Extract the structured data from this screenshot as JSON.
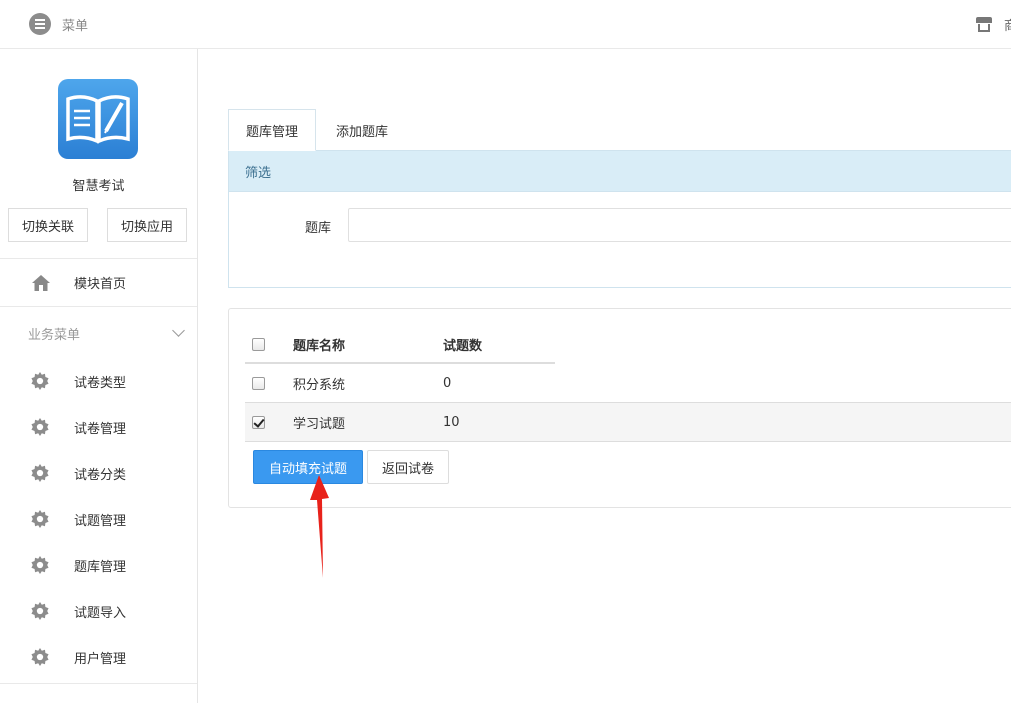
{
  "topbar": {
    "menu_label": "菜单",
    "menu_icon": "list-icon",
    "store_icon": "store-icon",
    "store_text": "商"
  },
  "sidebar": {
    "app_logo": "book-pen-logo",
    "app_name": "智慧考试",
    "switch_link": "切换关联",
    "switch_app": "切换应用",
    "home": {
      "label": "模块首页",
      "icon": "home-icon"
    },
    "section_title": "业务菜单",
    "items": [
      {
        "label": "试卷类型",
        "icon": "gear-icon"
      },
      {
        "label": "试卷管理",
        "icon": "gear-icon"
      },
      {
        "label": "试卷分类",
        "icon": "gear-icon"
      },
      {
        "label": "试题管理",
        "icon": "gear-icon"
      },
      {
        "label": "题库管理",
        "icon": "gear-icon"
      },
      {
        "label": "试题导入",
        "icon": "gear-icon"
      },
      {
        "label": "用户管理",
        "icon": "gear-icon"
      }
    ]
  },
  "tabs": [
    {
      "label": "题库管理",
      "active": true
    },
    {
      "label": "添加题库",
      "active": false
    }
  ],
  "filter": {
    "title": "筛选",
    "field_label": "题库",
    "field_value": ""
  },
  "table": {
    "headers": {
      "name": "题库名称",
      "count": "试题数"
    },
    "rows": [
      {
        "name": "积分系统",
        "count": "0",
        "checked": false
      },
      {
        "name": "学习试题",
        "count": "10",
        "checked": true
      }
    ]
  },
  "actions": {
    "primary": "自动填充试题",
    "secondary": "返回试卷"
  },
  "colors": {
    "primary": "#3a99f0",
    "filter_header_bg": "#d9edf7",
    "annotation_arrow": "#e8221b"
  }
}
